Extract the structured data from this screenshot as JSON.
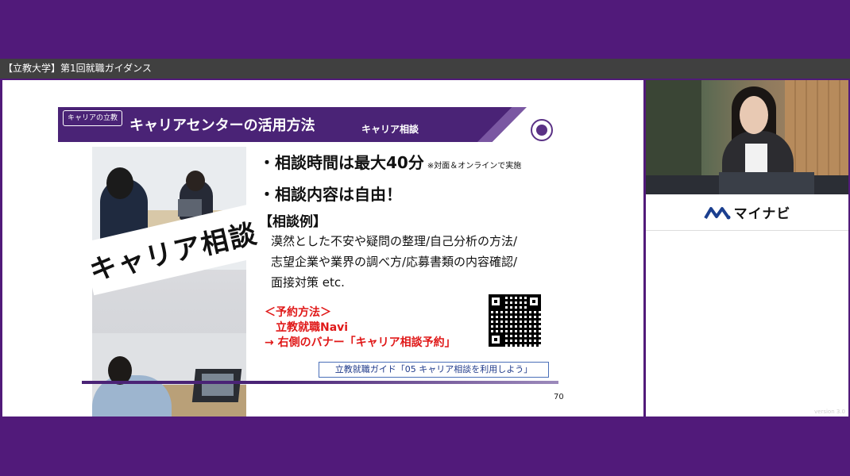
{
  "window": {
    "title": "【立教大学】第1回就職ガイダンス"
  },
  "slide": {
    "tag": "キャリアの立教",
    "title": "キャリアセンターの活用方法",
    "subtitle": "キャリア相談",
    "photo_caption": "キャリア相談",
    "bullet1": "・相談時間は最大40分",
    "bullet1_note": "※対面＆オンラインで実施",
    "bullet2": "・相談内容は自由！",
    "examples_heading": "【相談例】",
    "examples": [
      "漠然とした不安や疑問の整理/自己分析の方法/",
      "志望企業や業界の調べ方/応募書類の内容確認/",
      "面接対策 etc."
    ],
    "reservation": {
      "heading": "＜予約方法＞",
      "line1": "立教就職Navi",
      "line2": "→ 右側のバナー「キャリア相談予約」"
    },
    "guide": "立教就職ガイド「05 キャリア相談を利用しよう」",
    "page_number": "70",
    "icons": [
      "university-emblem-icon",
      "qr-code-icon"
    ]
  },
  "sidebar": {
    "logo_text": "マイナビ",
    "version": "version 3.0"
  },
  "colors": {
    "frame": "#511a7a",
    "titlebar": "#404040",
    "header": "#4a2376",
    "reservation_red": "#e01818",
    "guide_blue": "#1f3a8a"
  }
}
